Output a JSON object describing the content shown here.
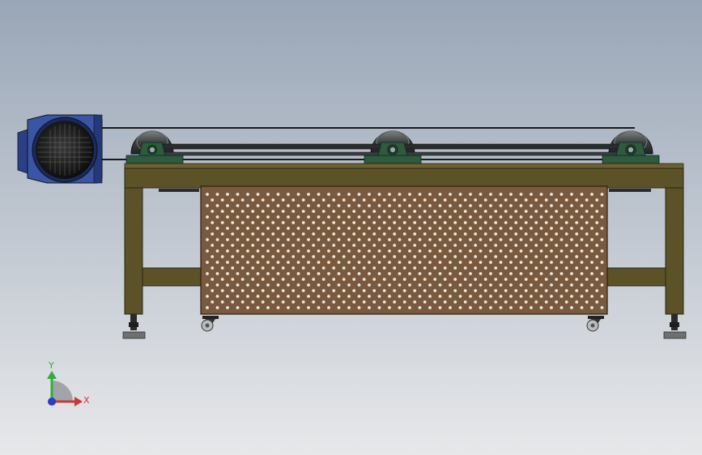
{
  "viewport": {
    "background_top": "#99a6b7",
    "background_bottom": "#e7e8ea"
  },
  "model": {
    "frame_color": "#5b5228",
    "frame_edge": "#2a2612",
    "panel_color": "#7a5a3e",
    "panel_hole_color": "#e9e4dd",
    "motor_color": "#3a55a6",
    "motor_dark": "#1b2a5c",
    "bearing_color": "#2f5a3e",
    "roller_color": "#3d4140",
    "belt_color": "#1b1b1b",
    "foot_color": "#6d6f70"
  },
  "triad": {
    "x_label": "X",
    "y_label": "Y",
    "x_color": "#c83a3a",
    "y_color": "#2fae3a",
    "z_color": "#2a3cc8"
  }
}
